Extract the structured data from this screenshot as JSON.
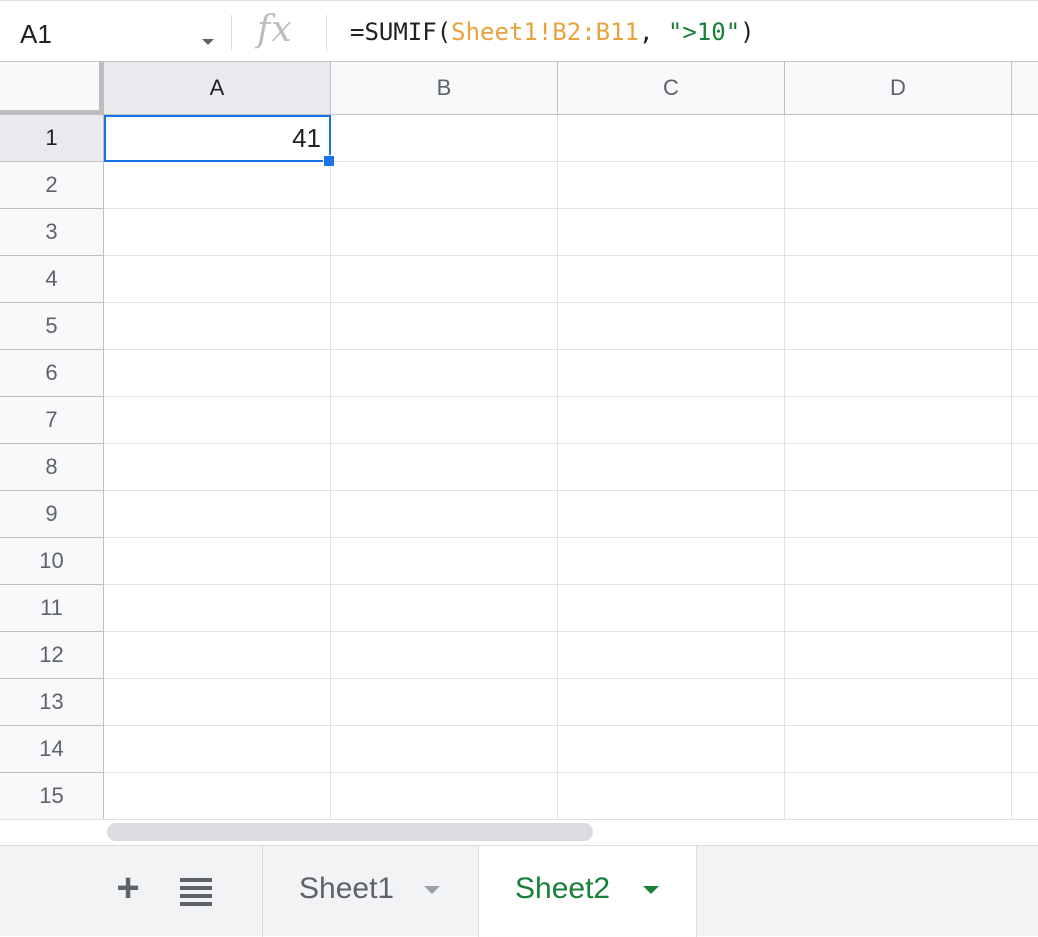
{
  "formula_bar": {
    "name_box": "A1",
    "fx_icon": "fx",
    "formula_prefix": "=SUMIF(",
    "formula_range": "Sheet1!B2:B11",
    "formula_sep": ", ",
    "formula_criteria": "\">10\"",
    "formula_suffix": ")"
  },
  "columns": [
    "A",
    "B",
    "C",
    "D"
  ],
  "rows": [
    "1",
    "2",
    "3",
    "4",
    "5",
    "6",
    "7",
    "8",
    "9",
    "10",
    "11",
    "12",
    "13",
    "14",
    "15"
  ],
  "active_cell": {
    "ref": "A1",
    "value": "41"
  },
  "sheet_tabs": {
    "add_icon": "+",
    "tabs": [
      {
        "label": "Sheet1",
        "active": false
      },
      {
        "label": "Sheet2",
        "active": true
      }
    ]
  },
  "colors": {
    "selection": "#1a73e8",
    "range_ref": "#e8a33d",
    "string_literal": "#188038",
    "active_tab": "#188038"
  }
}
